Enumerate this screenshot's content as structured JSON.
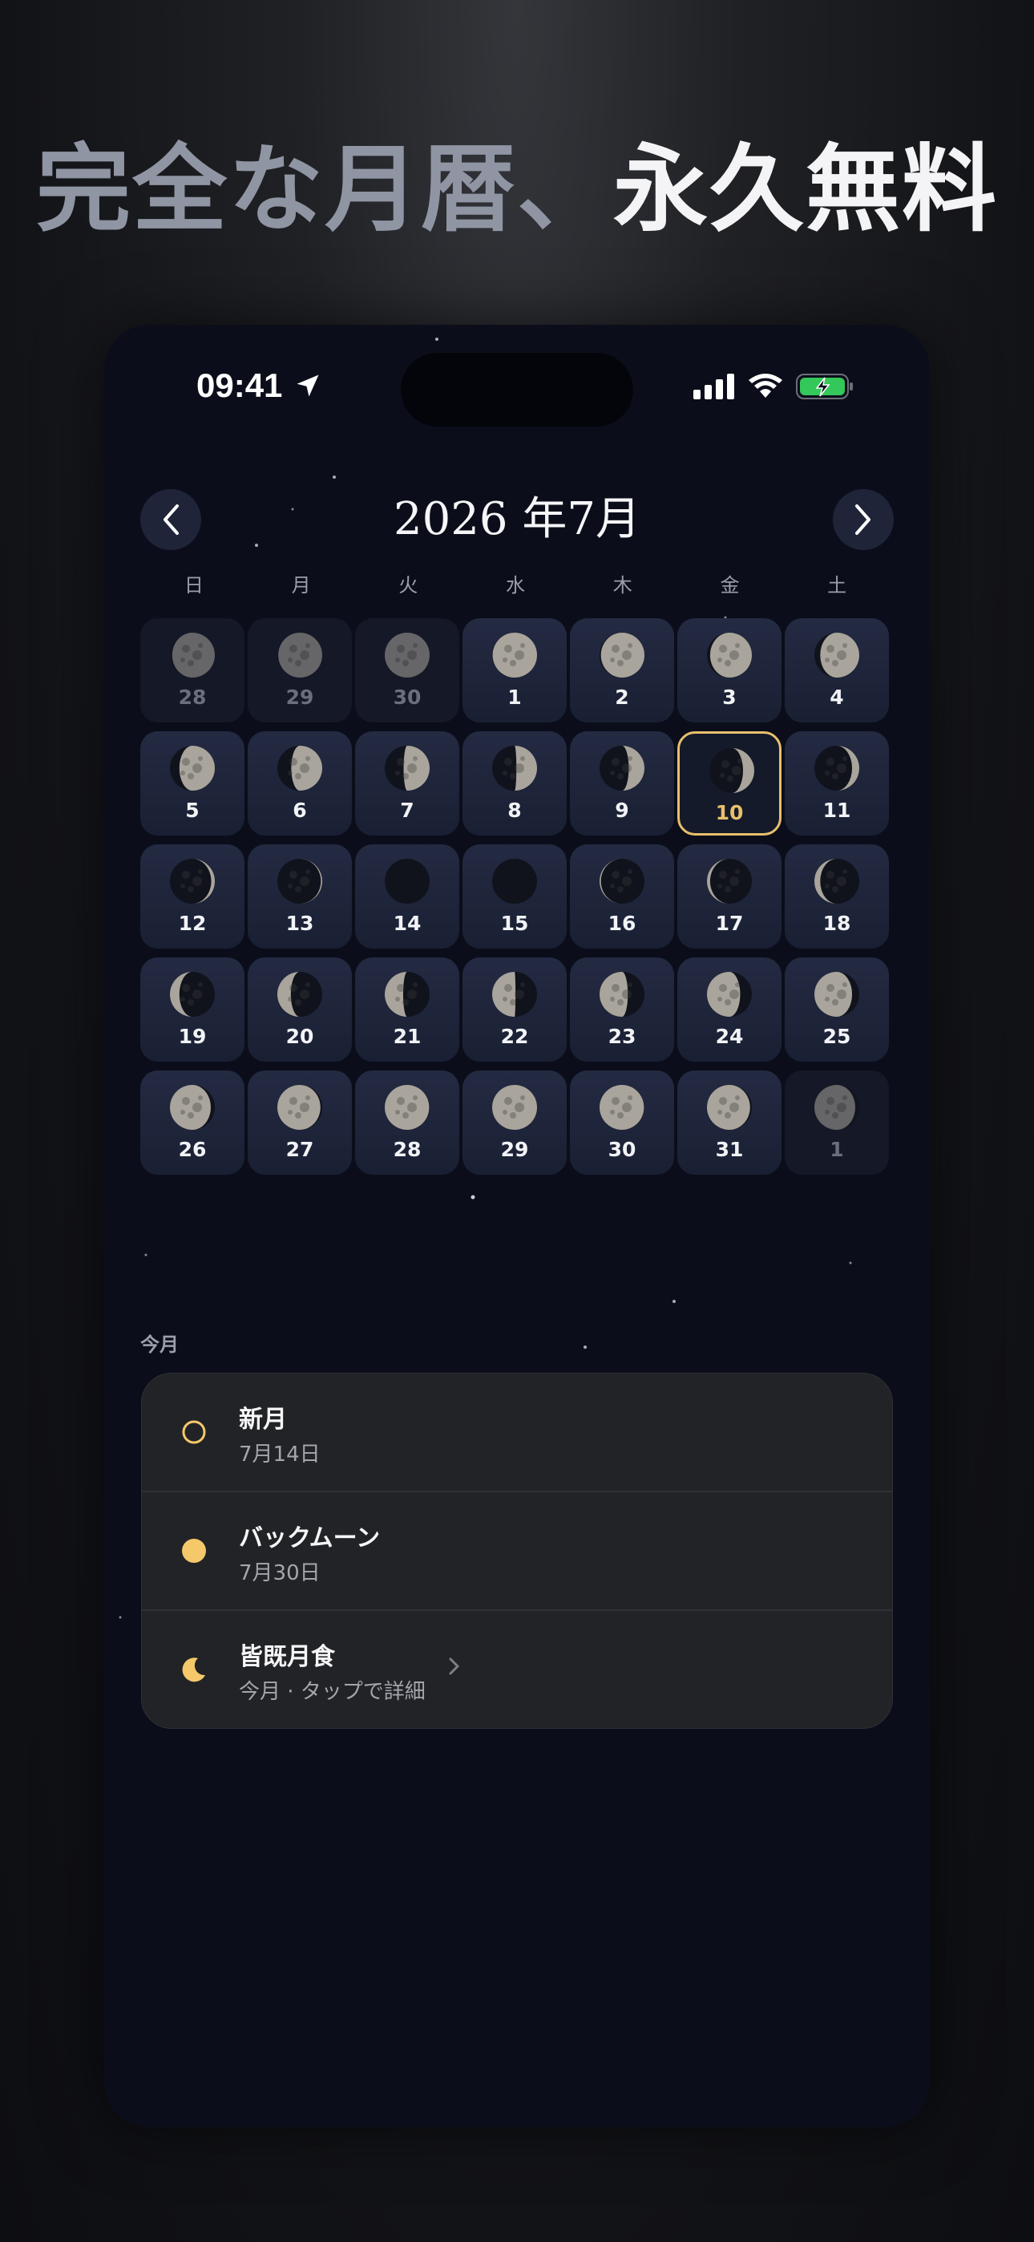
{
  "headline": {
    "part1": "完全な月暦、",
    "part2": "永久無料"
  },
  "status_bar": {
    "time": "09:41",
    "icons": [
      "location-arrow-icon",
      "signal-icon",
      "wifi-icon",
      "battery-charging-icon"
    ]
  },
  "calendar": {
    "title": "2026 年7月",
    "weekdays": [
      "日",
      "月",
      "火",
      "水",
      "木",
      "金",
      "土"
    ],
    "accent_color": "#e8c06c",
    "days": [
      {
        "label": "28",
        "phase": 0.95,
        "other": true
      },
      {
        "label": "29",
        "phase": 0.98,
        "other": true
      },
      {
        "label": "30",
        "phase": 1.0,
        "other": true
      },
      {
        "label": "1",
        "phase": 0.99
      },
      {
        "label": "2",
        "phase": 0.97
      },
      {
        "label": "3",
        "phase": 0.93
      },
      {
        "label": "4",
        "phase": 0.87
      },
      {
        "label": "5",
        "phase": 0.79
      },
      {
        "label": "6",
        "phase": 0.69
      },
      {
        "label": "7",
        "phase": 0.58
      },
      {
        "label": "8",
        "phase": 0.46
      },
      {
        "label": "9",
        "phase": 0.35
      },
      {
        "label": "10",
        "phase": 0.25,
        "today": true
      },
      {
        "label": "11",
        "phase": 0.16
      },
      {
        "label": "12",
        "phase": 0.08
      },
      {
        "label": "13",
        "phase": 0.03
      },
      {
        "label": "14",
        "phase": 0.0
      },
      {
        "label": "15",
        "phase": 0.01
      },
      {
        "label": "16",
        "phase": 0.03
      },
      {
        "label": "17",
        "phase": 0.07
      },
      {
        "label": "18",
        "phase": 0.13
      },
      {
        "label": "19",
        "phase": 0.21
      },
      {
        "label": "20",
        "phase": 0.3
      },
      {
        "label": "21",
        "phase": 0.41
      },
      {
        "label": "22",
        "phase": 0.52
      },
      {
        "label": "23",
        "phase": 0.63
      },
      {
        "label": "24",
        "phase": 0.74
      },
      {
        "label": "25",
        "phase": 0.84
      },
      {
        "label": "26",
        "phase": 0.91
      },
      {
        "label": "27",
        "phase": 0.96
      },
      {
        "label": "28",
        "phase": 0.99
      },
      {
        "label": "29",
        "phase": 1.0
      },
      {
        "label": "30",
        "phase": 0.99
      },
      {
        "label": "31",
        "phase": 0.96
      },
      {
        "label": "1",
        "phase": 0.91,
        "other": true
      }
    ]
  },
  "events": {
    "section_label": "今月",
    "items": [
      {
        "icon": "new-moon-icon",
        "title": "新月",
        "subtitle": "7月14日"
      },
      {
        "icon": "full-moon-icon",
        "title": "バックムーン",
        "subtitle": "7月30日"
      },
      {
        "icon": "crescent-moon-icon",
        "title": "皆既月食",
        "subtitle": "今月 · タップで詳細",
        "chevron": true
      }
    ]
  }
}
